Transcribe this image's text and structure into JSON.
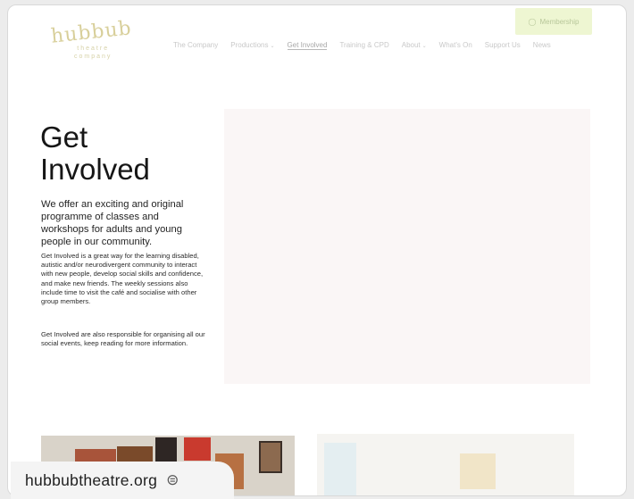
{
  "logo": {
    "word": "hubbub",
    "sub_line1": "theatre",
    "sub_line2": "company"
  },
  "nav": {
    "items": [
      {
        "label": "The Company",
        "chevron": false
      },
      {
        "label": "Productions",
        "chevron": true
      },
      {
        "label": "Get Involved",
        "chevron": false
      },
      {
        "label": "Training & CPD",
        "chevron": false
      },
      {
        "label": "About",
        "chevron": true
      },
      {
        "label": "What's On",
        "chevron": false
      },
      {
        "label": "Support Us",
        "chevron": false
      },
      {
        "label": "News",
        "chevron": false
      }
    ],
    "membership_label": "Membership",
    "membership_icon": "user-icon"
  },
  "page": {
    "title_line1": "Get",
    "title_line2": "Involved",
    "lead": "We offer an exciting and original programme of classes and workshops for adults and young people in our community.",
    "para1": "Get Involved is a great way for the learning disabled, autistic and/or neurodivergent community to interact with new people, develop social skills and confidence, and make new friends. The weekly sessions also include time to visit the café and socialise with other group members.",
    "para2": "Get Involved are also responsible for organising all our social events, keep reading for more information."
  },
  "footer_pill": {
    "url": "hubbubtheatre.org",
    "icon": "link-icon"
  },
  "colors": {
    "accent_button": "#eef6d2",
    "logo": "#d8cf9a",
    "title": "#161616"
  }
}
